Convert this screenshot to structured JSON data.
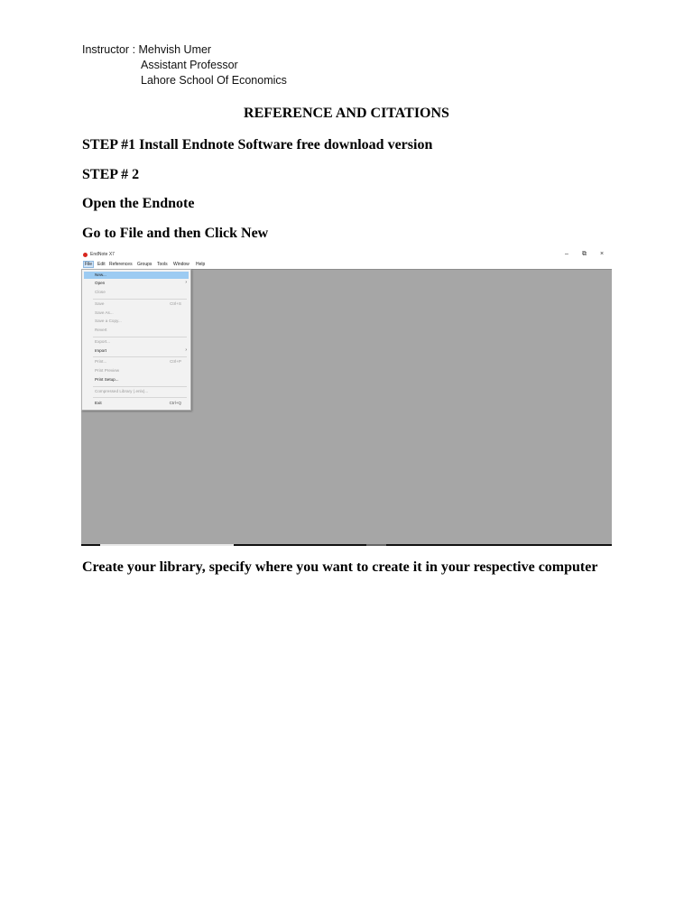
{
  "header": {
    "instructor_line": "Instructor : Mehvish Umer",
    "position": "Assistant Professor",
    "institution": "Lahore School Of Economics"
  },
  "title": "REFERENCE AND CITATIONS",
  "steps": {
    "step1": "STEP #1 Install Endnote Software free download version",
    "step2": "STEP # 2",
    "open": "Open the Endnote",
    "goto": "Go to File and then Click New",
    "create": "Create your library, specify where you want to create it in your respective computer"
  },
  "screenshot": {
    "app_title": "EndNote X7",
    "window_controls": {
      "minimize": "–",
      "restore": "⧉",
      "close": "×"
    },
    "menubar": [
      "File",
      "Edit",
      "References",
      "Groups",
      "Tools",
      "Window",
      "Help"
    ],
    "file_menu": [
      {
        "label": "New...",
        "shortcut": "",
        "disabled": false
      },
      {
        "label": "Open",
        "shortcut": "",
        "disabled": false,
        "submenu": true
      },
      {
        "label": "Close",
        "shortcut": "",
        "disabled": true
      },
      {
        "label": "Save",
        "shortcut": "Ctrl+S",
        "disabled": true
      },
      {
        "label": "Save As...",
        "shortcut": "",
        "disabled": true
      },
      {
        "label": "Save a Copy...",
        "shortcut": "",
        "disabled": true
      },
      {
        "label": "Revert",
        "shortcut": "",
        "disabled": true
      },
      {
        "label": "Export...",
        "shortcut": "",
        "disabled": true
      },
      {
        "label": "Import",
        "shortcut": "",
        "disabled": false,
        "submenu": true
      },
      {
        "label": "Print...",
        "shortcut": "Ctrl+P",
        "disabled": true
      },
      {
        "label": "Print Preview",
        "shortcut": "",
        "disabled": true
      },
      {
        "label": "Print Setup...",
        "shortcut": "",
        "disabled": false
      },
      {
        "label": "Compressed Library (.enlx)...",
        "shortcut": "",
        "disabled": true
      },
      {
        "label": "Exit",
        "shortcut": "Ctrl+Q",
        "disabled": false
      }
    ]
  }
}
